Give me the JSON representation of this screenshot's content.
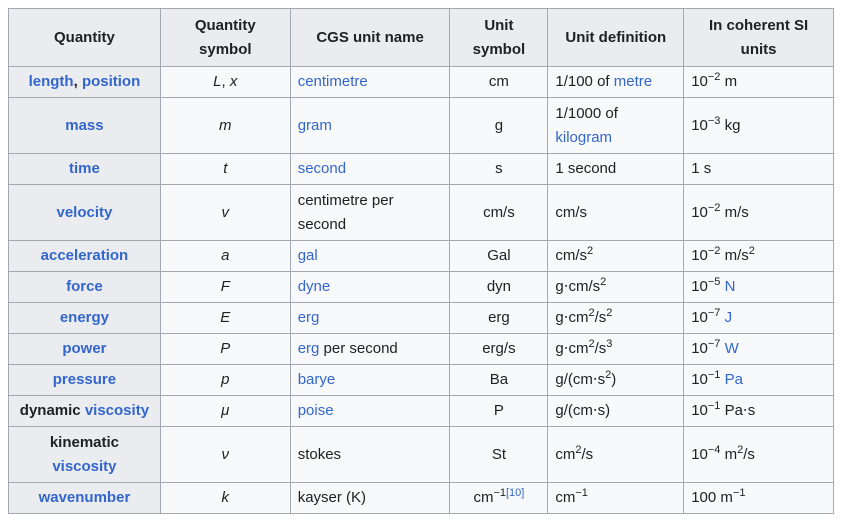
{
  "headers": {
    "quantity": "Quantity",
    "quantity_symbol": "Quantity symbol",
    "cgs_unit_name": "CGS unit name",
    "unit_symbol": "Unit symbol",
    "unit_definition": "Unit definition",
    "si_units": "In coherent SI units"
  },
  "rows": {
    "length": {
      "q_a": "length",
      "q_sep": ", ",
      "q_b": "position",
      "sym_a": "L",
      "sym_sep": ", ",
      "sym_b": "x",
      "name": "centimetre",
      "unit": "cm",
      "def_a": "1/100 of ",
      "def_b": "metre",
      "si_base": "10",
      "si_exp": "−2",
      "si_unit": " m"
    },
    "mass": {
      "q": "mass",
      "sym": "m",
      "name": "gram",
      "unit": "g",
      "def_a": "1/1000 of",
      "def_b": "kilogram",
      "si_base": "10",
      "si_exp": "−3",
      "si_unit": " kg"
    },
    "time": {
      "q": "time",
      "sym": "t",
      "name": "second",
      "unit": "s",
      "def": "1 second",
      "si": "1 s"
    },
    "velocity": {
      "q": "velocity",
      "sym": "v",
      "name_a": "centimetre per",
      "name_b": "second",
      "unit": "cm/s",
      "def": "cm/s",
      "si_base": "10",
      "si_exp": "−2",
      "si_unit": " m/s"
    },
    "acceleration": {
      "q": "acceleration",
      "sym": "a",
      "name": "gal",
      "unit": "Gal",
      "def_a": "cm/s",
      "def_exp": "2",
      "si_base": "10",
      "si_exp": "−2",
      "si_unit": " m/s",
      "si_unit_exp": "2"
    },
    "force": {
      "q": "force",
      "sym": "F",
      "name": "dyne",
      "unit": "dyn",
      "def_a": "g⋅cm/s",
      "def_exp": "2",
      "si_base": "10",
      "si_exp": "−5",
      "si_sp": " ",
      "si_unit": "N"
    },
    "energy": {
      "q": "energy",
      "sym": "E",
      "name": "erg",
      "unit": "erg",
      "def_a": "g⋅cm",
      "def_exp1": "2",
      "def_b": "/s",
      "def_exp2": "2",
      "si_base": "10",
      "si_exp": "−7",
      "si_sp": " ",
      "si_unit": "J"
    },
    "power": {
      "q": "power",
      "sym": "P",
      "name_a": "erg",
      "name_b": " per second",
      "unit": "erg/s",
      "def_a": "g⋅cm",
      "def_exp1": "2",
      "def_b": "/s",
      "def_exp2": "3",
      "si_base": "10",
      "si_exp": "−7",
      "si_sp": " ",
      "si_unit": "W"
    },
    "pressure": {
      "q": "pressure",
      "sym": "p",
      "name": "barye",
      "unit": "Ba",
      "def_a": "g/(cm⋅s",
      "def_exp": "2",
      "def_b": ")",
      "si_base": "10",
      "si_exp": "−1",
      "si_sp": " ",
      "si_unit": "Pa"
    },
    "dynamic_viscosity": {
      "q_a": "dynamic ",
      "q_b": "viscosity",
      "sym": "μ",
      "name": "poise",
      "unit": "P",
      "def": "g/(cm⋅s)",
      "si_base": "10",
      "si_exp": "−1",
      "si_unit": " Pa⋅s"
    },
    "kinematic_viscosity": {
      "q_a": "kinematic",
      "q_b": "viscosity",
      "sym": "ν",
      "name": "stokes",
      "unit": "St",
      "def_a": "cm",
      "def_exp": "2",
      "def_b": "/s",
      "si_base": "10",
      "si_exp": "−4",
      "si_unit": " m",
      "si_unit_exp": "2",
      "si_unit_b": "/s"
    },
    "wavenumber": {
      "q": "wavenumber",
      "sym": "k",
      "name": "kayser (K)",
      "unit_a": "cm",
      "unit_exp": "−1",
      "unit_ref": "[10]",
      "def_a": "cm",
      "def_exp": "−1",
      "si_a": "100 m",
      "si_exp": "−1"
    }
  },
  "colors": {
    "link": "#3366cc",
    "text": "#202122",
    "header_bg": "#eaecf0",
    "cell_bg": "#f8f9fa",
    "border": "#a2a9b1"
  }
}
